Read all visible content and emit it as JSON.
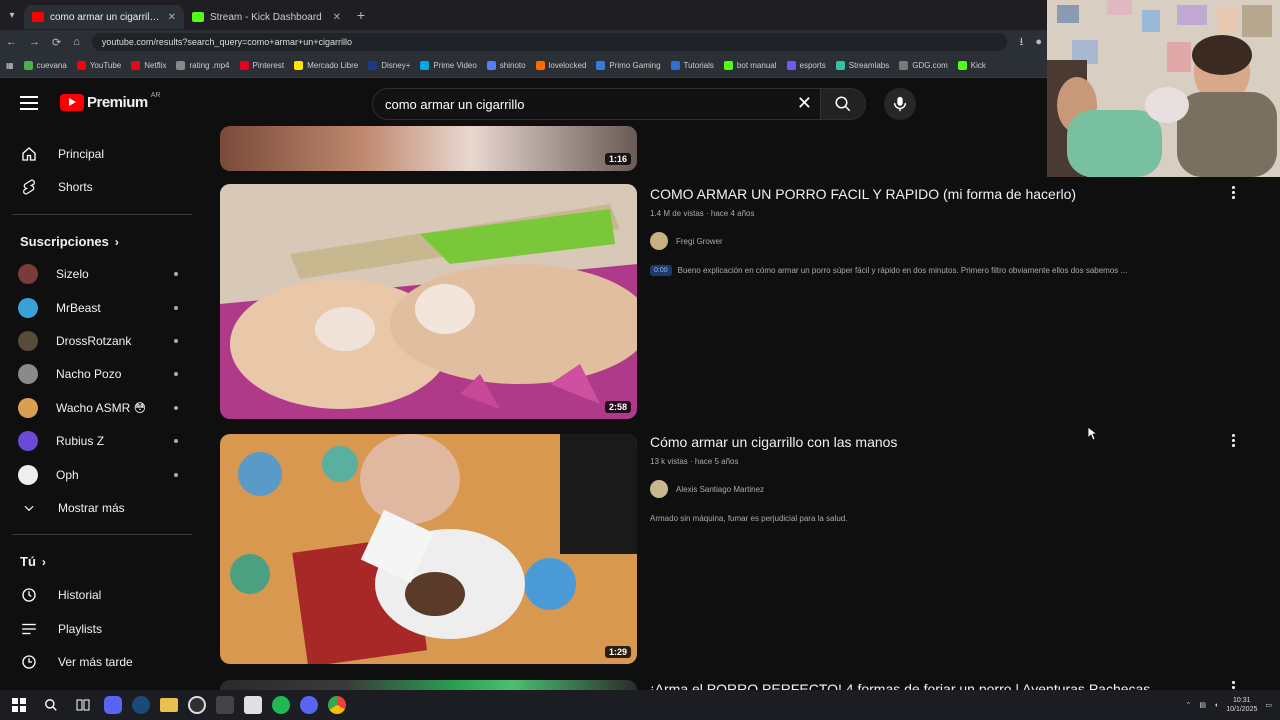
{
  "browser": {
    "tabs": [
      {
        "title": "como armar un cigarrillo - Yo",
        "favicon_color": "#ff0000",
        "active": true
      },
      {
        "title": "Stream - Kick Dashboard",
        "favicon_color": "#53fc18",
        "active": false
      }
    ],
    "url": "youtube.com/results?search_query=como+armar+un+cigarrillo",
    "bookmarks": [
      {
        "label": "cuevana",
        "color": "#4caf50"
      },
      {
        "label": "YouTube",
        "color": "#ff0000"
      },
      {
        "label": "Netflix",
        "color": "#e50914"
      },
      {
        "label": "rating .mp4",
        "color": "#888888"
      },
      {
        "label": "Pinterest",
        "color": "#e60023"
      },
      {
        "label": "Mercado Libre",
        "color": "#ffe600"
      },
      {
        "label": "Disney+",
        "color": "#1b3a8a"
      },
      {
        "label": "Prime Video",
        "color": "#00a8e1"
      },
      {
        "label": "shinoto",
        "color": "#5b7cfa"
      },
      {
        "label": "lovelocked",
        "color": "#ff6a00"
      },
      {
        "label": "Primo Gaming",
        "color": "#3a7bd5"
      },
      {
        "label": "Tutorials",
        "color": "#2f6fd6"
      },
      {
        "label": "bot manual",
        "color": "#53fc18"
      },
      {
        "label": "esports",
        "color": "#6e5bfa"
      },
      {
        "label": "Streamlabs",
        "color": "#31c3a2"
      },
      {
        "label": "GDG.com",
        "color": "#7a7a7a"
      },
      {
        "label": "Kick",
        "color": "#53fc18"
      }
    ]
  },
  "youtube": {
    "logo_text": "Premium",
    "region": "AR",
    "search_query": "como armar un cigarrillo"
  },
  "sidebar": {
    "top": [
      {
        "label": "Principal",
        "icon": "home-icon"
      },
      {
        "label": "Shorts",
        "icon": "shorts-icon"
      }
    ],
    "subscriptions_header": "Suscripciones",
    "subscriptions": [
      {
        "label": "Sizelo",
        "avatar_color": "#7a3b3b"
      },
      {
        "label": "MrBeast",
        "avatar_color": "#3aa0d8"
      },
      {
        "label": "DrossRotzank",
        "avatar_color": "#5a4a3a"
      },
      {
        "label": "Nacho Pozo",
        "avatar_color": "#8a8a8a"
      },
      {
        "label": "Wacho ASMR 😳",
        "avatar_color": "#d8a050"
      },
      {
        "label": "Rubius Z",
        "avatar_color": "#6a4ad8"
      },
      {
        "label": "Oph",
        "avatar_color": "#eeeeee"
      }
    ],
    "show_more": "Mostrar más",
    "you_header": "Tú",
    "you_items": [
      {
        "label": "Historial",
        "icon": "history-icon"
      },
      {
        "label": "Playlists",
        "icon": "playlists-icon"
      },
      {
        "label": "Ver más tarde",
        "icon": "watch-later-icon"
      }
    ]
  },
  "results": [
    {
      "duration": "1:16",
      "partial": true
    },
    {
      "title": "COMO ARMAR UN PORRO FACIL Y RAPIDO (mi forma de hacerlo)",
      "meta": "1.4 M de vistas · hace 4 años",
      "channel": "Fregi Grower",
      "chip": "0:00",
      "description": "Bueno explicación en cómo armar un porro súper fácil y rápido en dos minutos. Primero filtro obviamente ellos dos sabemos ...",
      "duration": "2:58"
    },
    {
      "title": "Cómo armar un cigarrillo con las manos",
      "meta": "13 k vistas · hace 5 años",
      "channel": "Alexis Santiago Martinez",
      "description": "Armado sin máquina, fumar es perjudicial para la salud.",
      "duration": "1:29"
    },
    {
      "title": "¡Arma el PORRO PERFECTO! 4 formas de forjar un porro | Aventuras Pachecas"
    }
  ],
  "taskbar": {
    "time": "10:31",
    "date": "10/1/2025"
  }
}
